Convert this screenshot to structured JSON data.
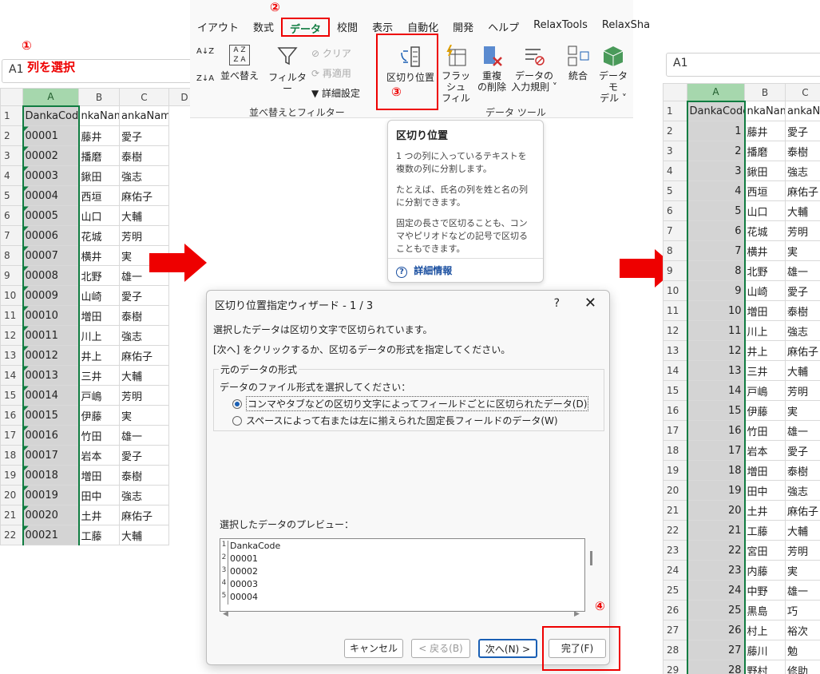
{
  "step1": {
    "marker": "①",
    "namebox": "A1",
    "label": "列を選択"
  },
  "step2": {
    "marker": "②"
  },
  "step3": {
    "marker": "③"
  },
  "step4": {
    "marker": "④"
  },
  "left_sheet": {
    "columns": [
      "A",
      "B",
      "C",
      "D"
    ],
    "rows": [
      [
        "1",
        "DankaCode",
        "nkaNam",
        "ankaName2"
      ],
      [
        "2",
        "00001",
        "藤井",
        "愛子"
      ],
      [
        "3",
        "00002",
        "播磨",
        "泰樹"
      ],
      [
        "4",
        "00003",
        "鍬田",
        "強志"
      ],
      [
        "5",
        "00004",
        "西垣",
        "麻佑子"
      ],
      [
        "6",
        "00005",
        "山口",
        "大輔"
      ],
      [
        "7",
        "00006",
        "花城",
        "芳明"
      ],
      [
        "8",
        "00007",
        "横井",
        " 実"
      ],
      [
        "9",
        "00008",
        "北野",
        " 雄一"
      ],
      [
        "10",
        "00009",
        "山崎",
        "愛子"
      ],
      [
        "11",
        "00010",
        "増田",
        "泰樹"
      ],
      [
        "12",
        "00011",
        "川上",
        "強志"
      ],
      [
        "13",
        "00012",
        "井上",
        "麻佑子"
      ],
      [
        "14",
        "00013",
        "三井",
        "大輔"
      ],
      [
        "15",
        "00014",
        "戸嶋",
        "芳明"
      ],
      [
        "16",
        "00015",
        "伊藤",
        " 実"
      ],
      [
        "17",
        "00016",
        "竹田",
        " 雄一"
      ],
      [
        "18",
        "00017",
        "岩本",
        "愛子"
      ],
      [
        "19",
        "00018",
        "増田",
        "泰樹"
      ],
      [
        "20",
        "00019",
        "田中",
        "強志"
      ],
      [
        "21",
        "00020",
        "土井",
        "麻佑子"
      ],
      [
        "22",
        "00021",
        "工藤",
        "大輔"
      ]
    ]
  },
  "ribbon": {
    "tabs": [
      "イアウト",
      "数式",
      "データ",
      "校閲",
      "表示",
      "自動化",
      "開発",
      "ヘルプ",
      "RelaxTools",
      "RelaxSha"
    ],
    "active_tab": "データ",
    "sort": "並べ替え",
    "filter": "フィルター",
    "clear": "クリア",
    "reapply": "再適用",
    "advanced": "詳細設定",
    "group_sort": "並べ替えとフィルター",
    "text_to_columns": "区切り位置",
    "flash_fill_1": "フラッシュ",
    "flash_fill_2": "フィル",
    "remove_dup_1": "重複",
    "remove_dup_2": "の削除",
    "validation_1": "データの",
    "validation_2": "入力規則 ˅",
    "consolidate": "統合",
    "model_1": "データ モ",
    "model_2": "デル ˅",
    "group_tools": "データ ツール",
    "sort_az": "A↓Z",
    "sort_za": "Z↓A"
  },
  "tooltip": {
    "title": "区切り位置",
    "p1": "1 つの列に入っているテキストを複数の列に分割します。",
    "p2": "たとえば、氏名の列を姓と名の列に分割できます。",
    "p3": "固定の長さで区切ることも、コンマやピリオドなどの記号で区切ることもできます。",
    "more": "詳細情報"
  },
  "dialog": {
    "title": "区切り位置指定ウィザード - 1 / 3",
    "help": "?",
    "close": "✕",
    "line1": "選択したデータは区切り文字で区切られています。",
    "line2": "[次へ] をクリックするか、区切るデータの形式を指定してください。",
    "group": "元のデータの形式",
    "choose": "データのファイル形式を選択してください：",
    "opt1": "コンマやタブなどの区切り文字によってフィールドごとに区切られたデータ(D)",
    "opt2": "スペースによって右または左に揃えられた固定長フィールドのデータ(W)",
    "preview_label": "選択したデータのプレビュー：",
    "preview": [
      {
        "n": "1",
        "v": "DankaCode"
      },
      {
        "n": "2",
        "v": "00001"
      },
      {
        "n": "3",
        "v": "00002"
      },
      {
        "n": "4",
        "v": "00003"
      },
      {
        "n": "5",
        "v": "00004"
      }
    ],
    "cancel": "キャンセル",
    "back": "< 戻る(B)",
    "next": "次へ(N) >",
    "finish": "完了(F)"
  },
  "right_sheet": {
    "namebox": "A1",
    "columns": [
      "A",
      "B",
      "C"
    ],
    "rows": [
      [
        "1",
        "DankaCode",
        "nkaNam",
        "ankaNa"
      ],
      [
        "2",
        "1",
        "藤井",
        "愛子"
      ],
      [
        "3",
        "2",
        "播磨",
        "泰樹"
      ],
      [
        "4",
        "3",
        "鍬田",
        "強志"
      ],
      [
        "5",
        "4",
        "西垣",
        "麻佑子"
      ],
      [
        "6",
        "5",
        "山口",
        "大輔"
      ],
      [
        "7",
        "6",
        "花城",
        "芳明"
      ],
      [
        "8",
        "7",
        "横井",
        " 実"
      ],
      [
        "9",
        "8",
        "北野",
        " 雄一"
      ],
      [
        "10",
        "9",
        "山崎",
        "愛子"
      ],
      [
        "11",
        "10",
        "増田",
        "泰樹"
      ],
      [
        "12",
        "11",
        "川上",
        "強志"
      ],
      [
        "13",
        "12",
        "井上",
        "麻佑子"
      ],
      [
        "14",
        "13",
        "三井",
        "大輔"
      ],
      [
        "15",
        "14",
        "戸嶋",
        "芳明"
      ],
      [
        "16",
        "15",
        "伊藤",
        " 実"
      ],
      [
        "17",
        "16",
        "竹田",
        " 雄一"
      ],
      [
        "18",
        "17",
        "岩本",
        "愛子"
      ],
      [
        "19",
        "18",
        "増田",
        "泰樹"
      ],
      [
        "20",
        "19",
        "田中",
        "強志"
      ],
      [
        "21",
        "20",
        "土井",
        "麻佑子"
      ],
      [
        "22",
        "21",
        "工藤",
        "大輔"
      ],
      [
        "23",
        "22",
        "宮田",
        "芳明"
      ],
      [
        "24",
        "23",
        "内藤",
        " 実"
      ],
      [
        "25",
        "24",
        "中野",
        " 雄一"
      ],
      [
        "26",
        "25",
        "黒島",
        "巧"
      ],
      [
        "27",
        "26",
        "村上",
        "裕次"
      ],
      [
        "28",
        "27",
        "藤川",
        "勉"
      ],
      [
        "29",
        "28",
        "野村",
        "修助"
      ]
    ]
  },
  "colors": {
    "red": "#e00000",
    "excel_green": "#107c41",
    "selection_gray": "#d4d4d4"
  }
}
